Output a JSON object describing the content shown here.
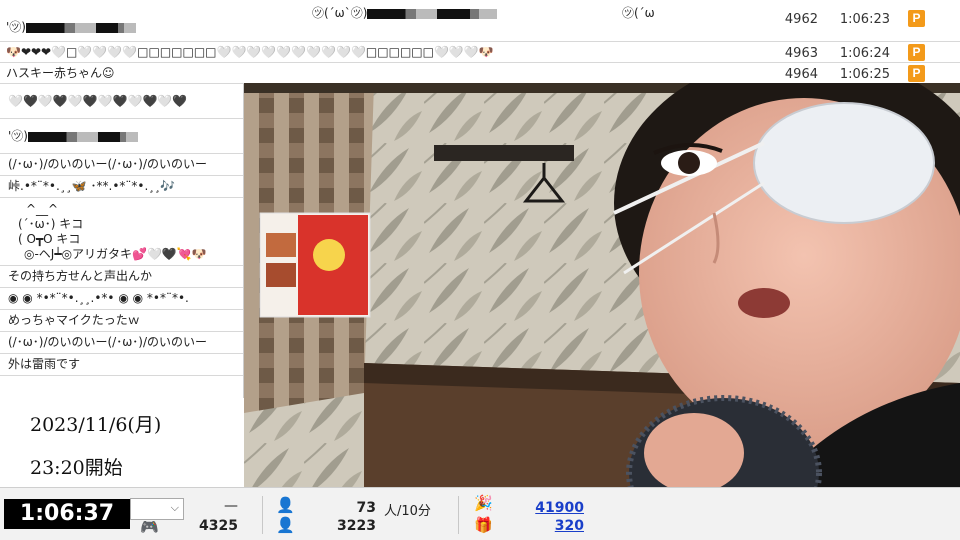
{
  "comments_top": [
    {
      "user_label": "'㋡)",
      "upper_text_1": "㋡(´ω`㋡)",
      "upper_text_2": "㋡(´ω",
      "number": "4962",
      "time": "1:06:23",
      "badge": "P"
    },
    {
      "text": "🐶❤❤❤🤍□🤍🤍🤍🤍□□□□□□□🤍🤍🤍🤍🤍🤍🤍🤍🤍🤍□□□□□□🤍🤍🤍🐶",
      "number": "4963",
      "time": "1:06:24",
      "badge": "P"
    },
    {
      "text": "ハスキー赤ちゃん☺",
      "number": "4964",
      "time": "1:06:25",
      "badge": "P"
    }
  ],
  "comments_left": [
    "🤍🖤🤍🖤🤍🖤🤍🖤🤍🖤🤍🖤",
    "'㋡)",
    "(/･ω･)/のいのいー(/･ω･)/のいのいー",
    "峠.•*¨*•.¸¸🦋 ･**.•*¨*•.¸¸🎶",
    "^__^",
    "(´･ω･) キコ",
    "( O┳O キコ",
    "◎-ヘJ┷◎アリガタキ💕🤍🖤💘🐶",
    "その持ち方せんと声出んか",
    "◉ ◉ *•*¨*•.¸¸.•*• ◉ ◉ *•*¨*•.",
    "めっちゃマイクたったｗ",
    "(/･ω･)/のいのいー(/･ω･)/のいのいー",
    "外は雷雨です"
  ],
  "broadcast": {
    "date": "2023/11/6(月)",
    "start": "23:20開始"
  },
  "status": {
    "elapsed": "1:06:37",
    "quality_value": "",
    "ad_dash": "—",
    "ad_count": "4325",
    "viewers_per_10min": "73",
    "viewers_unit": "人/10分",
    "total_viewers": "3223",
    "points": "41900",
    "gifts": "320"
  },
  "icons": [
    "heart-icon",
    "dog-icon",
    "game-controller-icon",
    "person-icon",
    "cracker-icon",
    "gift-icon",
    "chevron-down-icon",
    "p-badge-icon"
  ],
  "colors": {
    "badge": "#f39a1a",
    "timer_bg": "#000000",
    "link": "#1a3fc9"
  }
}
